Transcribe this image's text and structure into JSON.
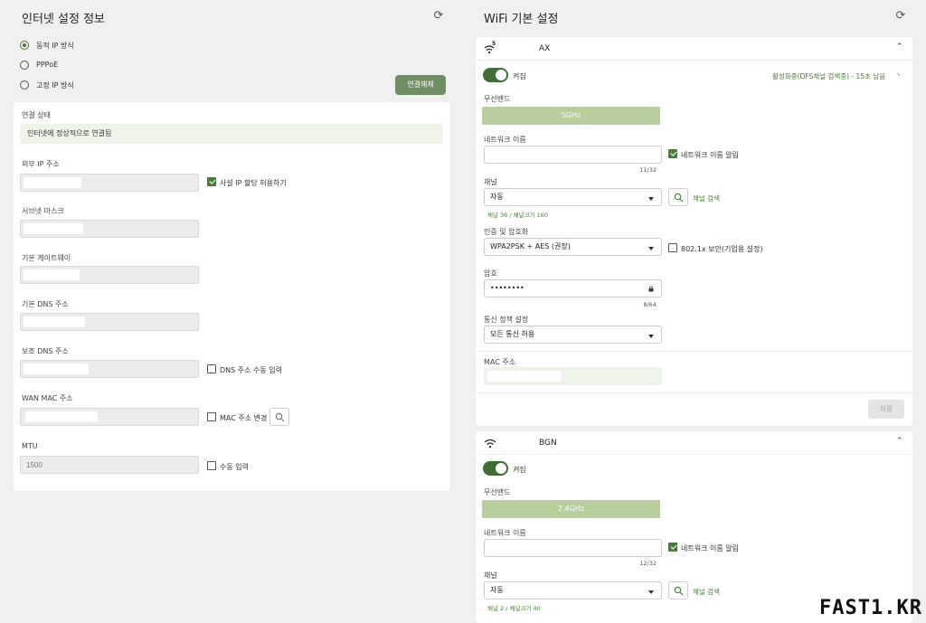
{
  "internet": {
    "title": "인터넷 설정 정보",
    "mode_options": [
      "동적 IP 방식",
      "PPPoE",
      "고정 IP 방식"
    ],
    "selected_mode": "동적 IP 방식",
    "disconnect_label": "연결해제",
    "conn_status_label": "연결 상태",
    "conn_status_value": "인터넷에 정상적으로 연결됨",
    "wan_ip_label": "외부 IP 주소",
    "private_ip_label": "사설 IP 할당 허용하기",
    "subnet_label": "서브넷 마스크",
    "gateway_label": "기본 게이트웨이",
    "dns1_label": "기본 DNS 주소",
    "dns2_label": "보조 DNS 주소",
    "dns_manual_label": "DNS 주소 수동 입력",
    "wan_mac_label": "WAN MAC 주소",
    "mac_change_label": "MAC 주소 변경",
    "mtu_label": "MTU",
    "mtu_placeholder": "1500",
    "mtu_manual_label": "수동 입력"
  },
  "wifi": {
    "title": "WiFi 기본 설정",
    "ax": {
      "name": "AX",
      "band_icon_sup": "5",
      "toggle_label": "켜짐",
      "status_text": "활성화중(DFS채널 검색중) - 15초 남음",
      "band_label": "무선밴드",
      "band_value": "5GHz",
      "ssid_label": "네트워크 이름",
      "ssid_counter": "11/32",
      "ssid_broadcast_label": "네트워크 이름 알림",
      "channel_label": "채널",
      "channel_value": "자동",
      "channel_search_label": "채널 검색",
      "channel_hint": "채널 36 / 채널크기 160",
      "auth_label": "인증 및 암호화",
      "auth_value": "WPA2PSK + AES (권장)",
      "enterprise_label": "802.1x 보안(기업용 설정)",
      "password_label": "암호",
      "password_value": "••••••••",
      "password_counter": "8/64",
      "policy_label": "통신 정책 설정",
      "policy_value": "모든 통신 허용",
      "mac_label": "MAC 주소",
      "apply_label": "적용"
    },
    "bgn": {
      "name": "BGN",
      "toggle_label": "켜짐",
      "band_label": "무선밴드",
      "band_value": "2.4GHz",
      "ssid_label": "네트워크 이름",
      "ssid_counter": "12/32",
      "ssid_broadcast_label": "네트워크 이름 알림",
      "channel_label": "채널",
      "channel_value": "자동",
      "channel_search_label": "채널 검색",
      "channel_hint": "채널 2 / 채널크기 40"
    }
  },
  "watermark": "FAST1.KR",
  "colors": {
    "accent": "#4a7a3a",
    "button": "#6f8e62",
    "band_bar": "#b7cf9c",
    "status_bg": "#eef4ea"
  }
}
